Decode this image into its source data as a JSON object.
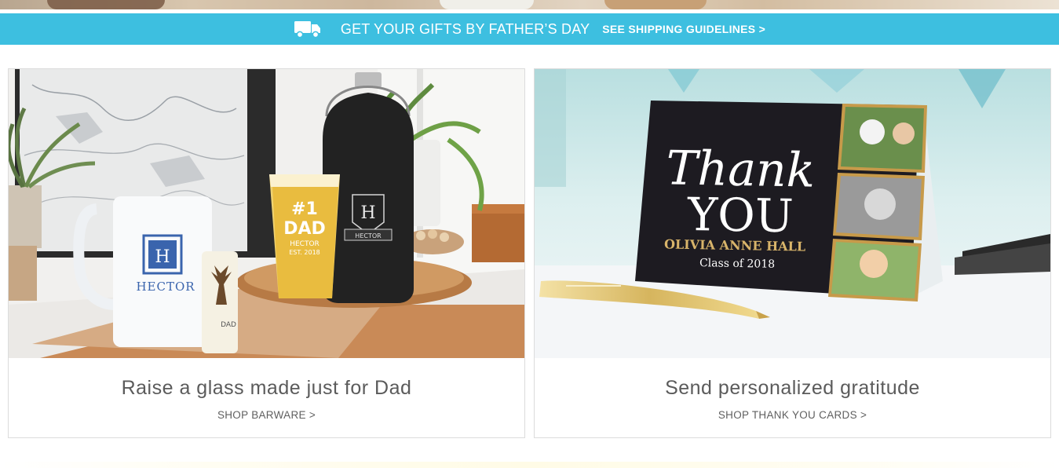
{
  "promo": {
    "icon": "truck-icon",
    "text": "GET YOUR GIFTS BY FATHER’S DAY",
    "link": "SEE SHIPPING GUIDELINES >"
  },
  "cards": [
    {
      "caption": "Raise a glass made just for Dad",
      "link": "SHOP BARWARE >",
      "image_text": {
        "mug_monogram": "H",
        "mug_name": "HECTOR",
        "glass_line1": "#1",
        "glass_line2": "DAD",
        "glass_line3": "HECTOR",
        "glass_line4": "EST. 2018",
        "growler_monogram": "H",
        "growler_name": "HECTOR",
        "shot_label": "DAD"
      }
    },
    {
      "caption": "Send personalized gratitude",
      "link": "SHOP THANK YOU CARDS >",
      "image_text": {
        "script": "Thank",
        "big": "YOU",
        "name": "OLIVIA ANNE HALL",
        "class": "Class of 2018"
      }
    }
  ],
  "colors": {
    "promo_bar": "#3dbfe0",
    "caption_text": "#5b5b5b",
    "card_border": "#dcdcdc",
    "card_gold": "#d8b46a"
  }
}
